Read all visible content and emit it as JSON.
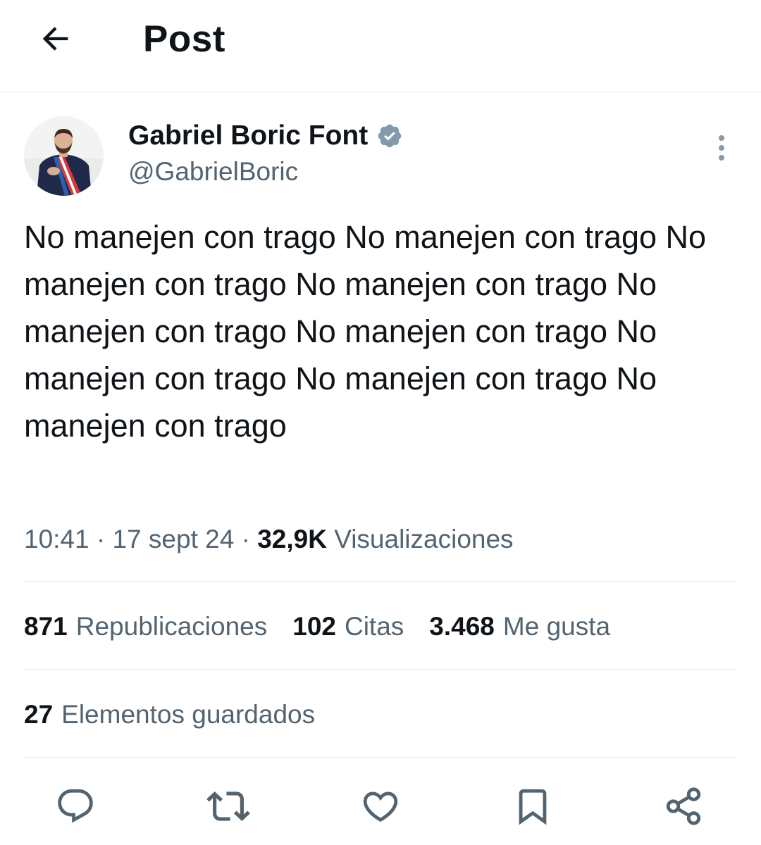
{
  "header": {
    "back_icon": "arrow-left-icon",
    "title": "Post"
  },
  "author": {
    "name": "Gabriel Boric Font",
    "handle": "@GabrielBoric",
    "verified": true,
    "verified_color": "#829aab",
    "avatar_icon": "profile-photo"
  },
  "post": {
    "text": "No manejen con trago No manejen con trago No manejen con trago No manejen con trago No manejen con trago No manejen con trago No manejen con trago No manejen con trago No manejen con trago",
    "time": "10:41",
    "date": "17 sept 24",
    "views_count": "32,9K",
    "views_label": "Visualizaciones",
    "separator": "·"
  },
  "stats": [
    {
      "count": "871",
      "label": "Republicaciones"
    },
    {
      "count": "102",
      "label": "Citas"
    },
    {
      "count": "3.468",
      "label": "Me gusta"
    }
  ],
  "saved": {
    "count": "27",
    "label": "Elementos guardados"
  },
  "actions": [
    {
      "icon": "reply-icon"
    },
    {
      "icon": "repost-icon"
    },
    {
      "icon": "like-icon"
    },
    {
      "icon": "bookmark-icon"
    },
    {
      "icon": "share-icon"
    }
  ],
  "colors": {
    "text_primary": "#0f1419",
    "text_secondary": "#536471",
    "divider": "#e6e9eb"
  }
}
